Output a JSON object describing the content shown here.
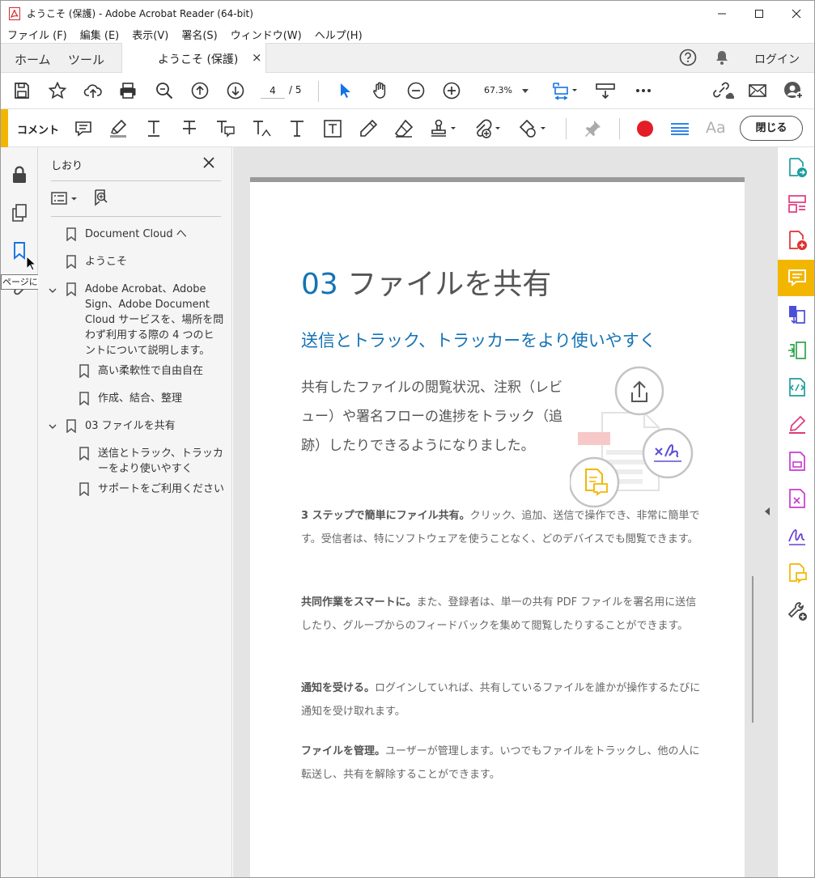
{
  "window": {
    "title": "ようこそ (保護) - Adobe Acrobat Reader (64-bit)"
  },
  "menu": [
    "ファイル (F)",
    "編集 (E)",
    "表示(V)",
    "署名(S)",
    "ウィンドウ(W)",
    "ヘルプ(H)"
  ],
  "tabs": {
    "home": "ホーム",
    "tools": "ツール",
    "document": "ようこそ (保護)",
    "login": "ログイン"
  },
  "toolbar": {
    "page_current": "4",
    "page_total": "/ 5",
    "zoom": "67.3%"
  },
  "comment_toolbar": {
    "label": "コメント",
    "text_style_label": "Aa",
    "close_label": "閉じる",
    "color_selected": "#e31e26"
  },
  "left_rail": {
    "tooltip": "ページに移動"
  },
  "bookmarks": {
    "title": "しおり",
    "items": [
      {
        "label": "Document Cloud へ"
      },
      {
        "label": "ようこそ"
      },
      {
        "label": "Adobe Acrobat、Adobe Sign、Adobe Document Cloud サービスを、場所を問わず利用する際の 4 つのヒントについて説明します。"
      },
      {
        "label": "高い柔軟性で自由自在"
      },
      {
        "label": "作成、結合、整理"
      },
      {
        "label": "03 ファイルを共有"
      },
      {
        "label": "送信とトラック、トラッカーをより使いやすく"
      },
      {
        "label": "サポートをご利用ください"
      }
    ]
  },
  "document": {
    "section_number": "03",
    "section_title": " ファイルを共有",
    "subtitle": "送信とトラック、トラッカーをより使いやすく",
    "lead": "共有したファイルの閲覧状況、注釈（レビュー）や署名フローの進捗をトラック（追跡）したりできるようになりました。",
    "paragraphs": [
      {
        "bold": "3 ステップで簡単にファイル共有。",
        "text": "クリック、追加、送信で操作でき、非常に簡単です。受信者は、特にソフトウェアを使うことなく、どのデバイスでも閲覧できます。"
      },
      {
        "bold": "共同作業をスマートに。",
        "text": "また、登録者は、単一の共有 PDF ファイルを署名用に送信したり、グループからのフィードバックを集めて閲覧したりすることができます。"
      },
      {
        "bold": "通知を受ける。",
        "text": "ログインしていれば、共有しているファイルを誰かが操作するたびに通知を受け取れます。"
      },
      {
        "bold": "ファイルを管理。",
        "text": "ユーザーが管理します。いつでもファイルをトラックし、他の人に転送し、共有を解除することができます。"
      }
    ]
  }
}
